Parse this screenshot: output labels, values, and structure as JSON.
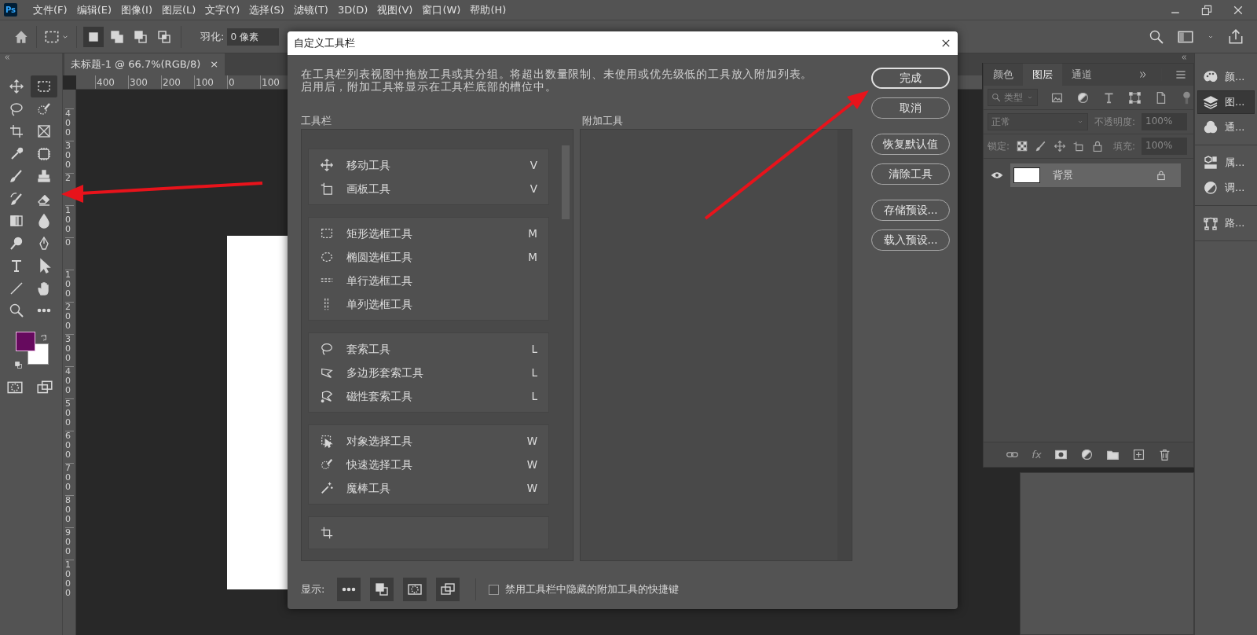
{
  "app_logo": "Ps",
  "menu": [
    "文件(F)",
    "编辑(E)",
    "图像(I)",
    "图层(L)",
    "文字(Y)",
    "选择(S)",
    "滤镜(T)",
    "3D(D)",
    "视图(V)",
    "窗口(W)",
    "帮助(H)"
  ],
  "options_bar": {
    "modes": [
      {
        "kind": "new",
        "selected": true
      },
      {
        "kind": "add",
        "selected": false
      },
      {
        "kind": "subtract",
        "selected": false
      },
      {
        "kind": "intersect",
        "selected": false
      }
    ],
    "feather_label": "羽化:",
    "feather_value": "0 像素"
  },
  "document_tab": {
    "title": "未标题-1 @ 66.7%(RGB/8)",
    "close": "×"
  },
  "ruler_h": [
    "400",
    "300",
    "200",
    "100",
    "0",
    "100"
  ],
  "ruler_v": [
    "400",
    "300",
    "2",
    "100",
    "0",
    "100",
    "200",
    "300",
    "400",
    "500",
    "600",
    "700",
    "800",
    "900",
    "1000"
  ],
  "toolbar": {
    "tools": [
      {
        "kind": "move",
        "selected": false
      },
      {
        "kind": "marquee",
        "selected": true
      },
      {
        "kind": "lasso",
        "selected": false
      },
      {
        "kind": "quickselect",
        "selected": false
      },
      {
        "kind": "crop",
        "selected": false
      },
      {
        "kind": "frame",
        "selected": false
      },
      {
        "kind": "eyedropper",
        "selected": false
      },
      {
        "kind": "healing",
        "selected": false
      },
      {
        "kind": "brush",
        "selected": false
      },
      {
        "kind": "stamp",
        "selected": false
      },
      {
        "kind": "historybrush",
        "selected": false
      },
      {
        "kind": "eraser",
        "selected": false
      },
      {
        "kind": "gradient",
        "selected": false
      },
      {
        "kind": "blur",
        "selected": false
      },
      {
        "kind": "dodge",
        "selected": false
      },
      {
        "kind": "pen",
        "selected": false
      },
      {
        "kind": "type",
        "selected": false
      },
      {
        "kind": "pathselect",
        "selected": false
      },
      {
        "kind": "line",
        "selected": false
      },
      {
        "kind": "hand",
        "selected": false
      },
      {
        "kind": "zoom",
        "selected": false
      },
      {
        "kind": "more",
        "selected": false
      }
    ],
    "swatches": [
      {
        "kind": "foreground",
        "color": "#660a5e"
      },
      {
        "kind": "background",
        "color": "#ffffff"
      }
    ]
  },
  "dialog": {
    "title": "自定义工具栏",
    "description": "在工具栏列表视图中拖放工具或其分组。将超出数量限制、未使用或优先级低的工具放入附加列表。启用后，附加工具将显示在工具栏底部的槽位中。",
    "toolbar_label": "工具栏",
    "extra_label": "附加工具",
    "groups": [
      {
        "tools": [
          {
            "kind": "move",
            "name": "移动工具",
            "key": "V"
          },
          {
            "kind": "artboard",
            "name": "画板工具",
            "key": "V"
          }
        ]
      },
      {
        "tools": [
          {
            "kind": "marquee",
            "name": "矩形选框工具",
            "key": "M"
          },
          {
            "kind": "ellipse",
            "name": "椭圆选框工具",
            "key": "M"
          },
          {
            "kind": "row",
            "name": "单行选框工具"
          },
          {
            "kind": "column",
            "name": "单列选框工具"
          }
        ]
      },
      {
        "tools": [
          {
            "kind": "lasso",
            "name": "套索工具",
            "key": "L"
          },
          {
            "kind": "polylasso",
            "name": "多边形套索工具",
            "key": "L"
          },
          {
            "kind": "maglasso",
            "name": "磁性套索工具",
            "key": "L"
          }
        ]
      },
      {
        "tools": [
          {
            "kind": "objectselect",
            "name": "对象选择工具",
            "key": "W"
          },
          {
            "kind": "quickselect",
            "name": "快速选择工具",
            "key": "W"
          },
          {
            "kind": "wand",
            "name": "魔棒工具",
            "key": "W"
          }
        ]
      },
      {
        "tools": [
          {
            "kind": "crop"
          }
        ]
      }
    ],
    "buttons": [
      {
        "label": "完成",
        "kind": "primary"
      },
      {
        "label": "取消",
        "kind": "plain"
      },
      {
        "label": "恢复默认值",
        "kind": "spaced"
      },
      {
        "label": "清除工具",
        "kind": "plain"
      },
      {
        "label": "存储预设...",
        "kind": "spaced"
      },
      {
        "label": "载入预设...",
        "kind": "plain"
      }
    ],
    "show_label": "显示:",
    "show_buttons": [
      {
        "kind": "more"
      },
      {
        "kind": "defaultcolors"
      },
      {
        "kind": "quickmask"
      },
      {
        "kind": "screenmode"
      }
    ],
    "checkbox": {
      "label": "禁用工具栏中隐藏的附加工具的快捷键",
      "checked": false
    }
  },
  "layers_panel": {
    "tabs": [
      {
        "label": "颜色",
        "selected": false
      },
      {
        "label": "图层",
        "selected": true
      },
      {
        "label": "通道",
        "selected": false
      }
    ],
    "filter": "类型",
    "blend_mode": "正常",
    "opacity_label": "不透明度:",
    "opacity": "100%",
    "lock_label": "锁定:",
    "fill_label": "填充:",
    "fill": "100%",
    "options_disabled": true,
    "layers": [
      {
        "name": "背景",
        "visible": true,
        "locked": true,
        "selected": true
      }
    ],
    "fx": "fx"
  },
  "dock": [
    {
      "items": [
        {
          "kind": "palette",
          "label": "颜...",
          "selected": false
        },
        {
          "kind": "layers",
          "label": "图...",
          "selected": true
        },
        {
          "kind": "channels",
          "label": "通...",
          "selected": false
        }
      ]
    },
    {
      "items": [
        {
          "kind": "properties",
          "label": "属...",
          "selected": false
        },
        {
          "kind": "adjust",
          "label": "调...",
          "selected": false
        }
      ]
    },
    {
      "items": [
        {
          "kind": "paths",
          "label": "路...",
          "selected": false
        }
      ]
    }
  ]
}
